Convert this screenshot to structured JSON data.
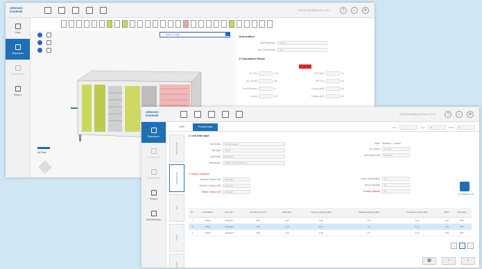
{
  "window1": {
    "logo": "Johnson Controls",
    "header_title": "DS4 Air Handling Unit | v1.0.2",
    "header_buttons": [
      "?",
      "⌂",
      "⚙"
    ],
    "sidebar": [
      {
        "label": "Units",
        "active": false,
        "disabled": false
      },
      {
        "label": "Sequencer",
        "active": true,
        "disabled": false
      },
      {
        "label": "Performance",
        "active": false,
        "disabled": true
      },
      {
        "label": "Report",
        "active": false,
        "disabled": false
      }
    ],
    "config_select": "-- Quick Config --",
    "airflow_label": "Air Flow",
    "info": {
      "title": "Information",
      "unit_placement_label": "Unit Placement",
      "unit_placement_value": "Indoor",
      "unit_connections_label": "Unit Connections",
      "unit_connections_value": "Left",
      "calc_title": "E Calculation Result",
      "results": [
        {
          "label": "Air Flow",
          "unit": "m³/h"
        },
        {
          "label": "ESP Static",
          "unit": "Pa"
        },
        {
          "label": "Air Velocity",
          "unit": "m/s"
        },
        {
          "label": "SFP Fan",
          "unit": "kW"
        },
        {
          "label": "Total Efficiency",
          "unit": "%"
        },
        {
          "label": "Cooling (kW)",
          "unit": "kW"
        },
        {
          "label": "Cooling",
          "unit": "kW"
        },
        {
          "label": "Heating (kW)",
          "unit": "kW"
        }
      ]
    }
  },
  "window2": {
    "logo": "Johnson Controls",
    "header_title": "DS4 Air Handling Unit (ver 1.0.2)",
    "tabs": [
      "Units",
      "Product Data"
    ],
    "filters": [
      {
        "label": "Area",
        "value": ""
      },
      {
        "label": "Type",
        "value": "All"
      },
      {
        "label": "Model",
        "value": "E"
      }
    ],
    "sidebar": [
      {
        "label": "Sequencer",
        "active": true,
        "disabled": false
      },
      {
        "label": "Parameters",
        "active": false,
        "disabled": true
      },
      {
        "label": "Performance",
        "active": false,
        "disabled": true
      },
      {
        "label": "Report",
        "active": false,
        "disabled": false
      },
      {
        "label": "Unit Selection",
        "active": false,
        "disabled": false
      }
    ],
    "vertical_tabs": [
      "General Data",
      "Fan Selection",
      "Coil",
      "Filters",
      "Performance"
    ],
    "form": {
      "section1": "1. Unit Data Input",
      "fields": [
        {
          "label": "Unit Series",
          "value": "DS Air Handler"
        },
        {
          "label": "Unit Type",
          "value": "Indoor"
        },
        {
          "label": "Unit Model",
          "value": "Standard"
        },
        {
          "label": "Dimensions",
          "value": "3000 × 1700 × 1570 mm"
        }
      ],
      "mode_label": "Mode",
      "mode_options": [
        "Standard",
        "Custom"
      ],
      "right_fields": [
        {
          "label": "Air Volume",
          "value": "20 m³/h"
        },
        {
          "label": "Unit Height Limit",
          "value": "Standard"
        }
      ],
      "section2": "2. Design Conditions",
      "left_cond": [
        {
          "label": "Summer Outdoor DB",
          "value": "Standard"
        },
        {
          "label": "Summer Outdoor WB",
          "value": "Standard"
        },
        {
          "label": "Winter Outdoor DB",
          "value": "Standard"
        }
      ],
      "right_cond": [
        {
          "label": "Indoor Temperature",
          "value": "13"
        },
        {
          "label": "Indoor Humidity",
          "value": "13"
        },
        {
          "label": "Cooling Capacity",
          "value": "13"
        }
      ]
    },
    "table": {
      "headers": [
        "No.",
        "Unit Model",
        "Unit Type",
        "Air Volume (m³/h)",
        "ESP (Pa)",
        "Cooling Capacity (kW)",
        "Heating Capacity (kW)",
        "Fan Motor Power (kW)",
        "Price",
        "Remarks"
      ],
      "rows": [
        [
          "1",
          "DS01",
          "Standard",
          "5.60",
          "1.20",
          "2.30",
          "1.8",
          "2.10",
          "1.54",
          "OPT"
        ],
        [
          "2",
          "DS02",
          "Standard",
          "5.60",
          "1.20",
          "2.30",
          "1.8",
          "2.10",
          "1.54",
          "OPT"
        ],
        [
          "3",
          "DS03",
          "Standard",
          "5.60",
          "1.20",
          "2.30",
          "1.8",
          "2.10",
          "1.54",
          "OPT"
        ]
      ],
      "selected_row": 1
    },
    "pager": [
      "<",
      "1",
      ">"
    ],
    "brand_text": "Air Handling Unit"
  }
}
